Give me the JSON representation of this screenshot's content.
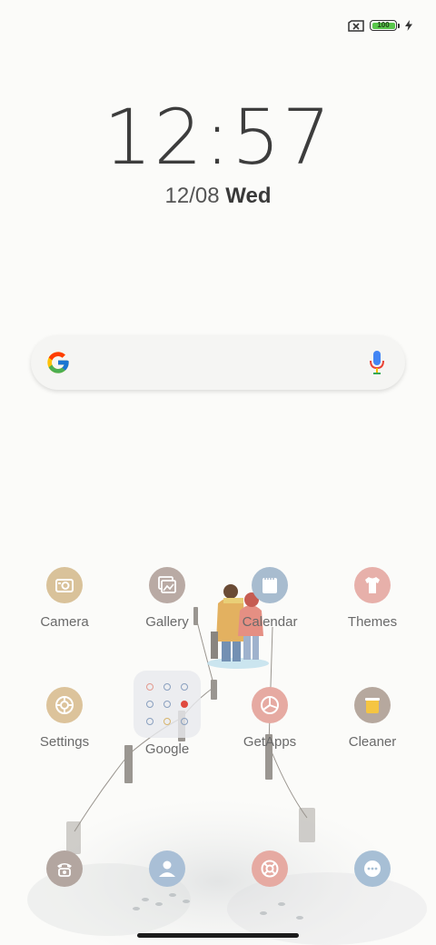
{
  "status_bar": {
    "sim_icon": "no-sim-icon",
    "battery_level": "100",
    "charging_icon": "bolt-icon",
    "battery_color": "#58c64a"
  },
  "lock": {
    "time": "12:57",
    "date": "12/08",
    "weekday": "Wed"
  },
  "search": {
    "logo": "google-g-icon",
    "mic": "microphone-icon"
  },
  "apps": [
    {
      "label": "Camera",
      "icon": "camera-icon",
      "color": "#d9c29a"
    },
    {
      "label": "Gallery",
      "icon": "gallery-icon",
      "color": "#b9aaa4"
    },
    {
      "label": "Calendar",
      "icon": "calendar-icon",
      "color": "#a8bccf"
    },
    {
      "label": "Themes",
      "icon": "tshirt-icon",
      "color": "#e7b0aa"
    },
    {
      "label": "Settings",
      "icon": "settings-icon",
      "color": "#dcc39b"
    },
    {
      "label": "Google",
      "icon": "folder-icon",
      "color": "#e4e6ea"
    },
    {
      "label": "GetApps",
      "icon": "getapps-icon",
      "color": "#e6aaa2"
    },
    {
      "label": "Cleaner",
      "icon": "trash-icon",
      "color": "#b6a89e"
    }
  ],
  "dock": [
    {
      "icon": "phone-icon",
      "color": "#b3a6a0"
    },
    {
      "icon": "contacts-icon",
      "color": "#a9bfd6"
    },
    {
      "icon": "browser-icon",
      "color": "#e6aaa2"
    },
    {
      "icon": "messages-icon",
      "color": "#a7bfd5"
    }
  ]
}
